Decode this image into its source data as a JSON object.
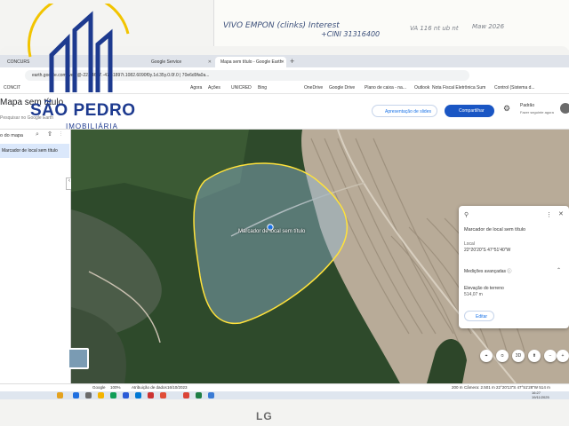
{
  "note": {
    "line1": "VIVO EMPON (clinks) Interest",
    "line2": "+ClNI 31316400",
    "line3": "VA 116 nt ub nt",
    "line4": "Maw 2026"
  },
  "browser": {
    "tabs": [
      {
        "label": "CONCURS"
      },
      {
        "label": "Google Service"
      },
      {
        "label": "Mapa sem título - Google Earth"
      }
    ],
    "new_tab": "+",
    "url": "earth.google.com/web/@-22.34677.-47.61897t.1082.6090f0y.1d.35y.0.0f.0 | 70e6d9fa0a...",
    "bookmarks": [
      "CONCIT",
      "Agora",
      "Ações",
      "UNICRED",
      "Bing",
      "OneDrive",
      "Google Drive",
      "Plano de caixa - na...",
      "Outlook",
      "Nota Fiscal Eletrônica",
      "Sum",
      "Control (Sistema d..."
    ]
  },
  "header": {
    "map_title": "Mapa sem título",
    "search_hint": "Pesquisar no Google Earth",
    "present_label": "Apresentação de slides",
    "share_label": "Compartilhar",
    "user_name": "Padrão",
    "user_sub": "Fazer seguinte agora"
  },
  "left_panel": {
    "title": "o do mapa",
    "icons": "⌕ ⇧ ⋮",
    "item_label": "Marcador de local sem título",
    "collapse": "‹"
  },
  "map": {
    "polygon_label": "Marcador de local sem título"
  },
  "card": {
    "title": "Marcador de local sem título",
    "location_label": "Local",
    "location_value": "22°20'20\"S 47°51'40\"W",
    "advanced_label": "Medições avançadas ⓘ",
    "elevation_label": "Elevação do terreno",
    "elevation_value": "514,07 m",
    "edit_label": "Editar",
    "more": "⋮",
    "close": "✕",
    "chevron": "⌃"
  },
  "controls": {
    "labels": [
      "⌖",
      "⦸",
      "3D",
      "⬆",
      "−",
      "+"
    ]
  },
  "status": {
    "google": "Google",
    "zoom": "100%",
    "data_attr": "Atribuição de dados",
    "date": "16/10/2023",
    "scale": "200 m",
    "camera": "Câmera: 2.501 m  22°20'13\"S 47°51'28\"W  514 m"
  },
  "taskbar": {
    "time": "16:27",
    "date": "19/11/2025"
  },
  "logo": {
    "title": "SÃO PEDRO",
    "sub": "IMOBILIÁRIA"
  },
  "monitor": {
    "brand": "LG"
  }
}
